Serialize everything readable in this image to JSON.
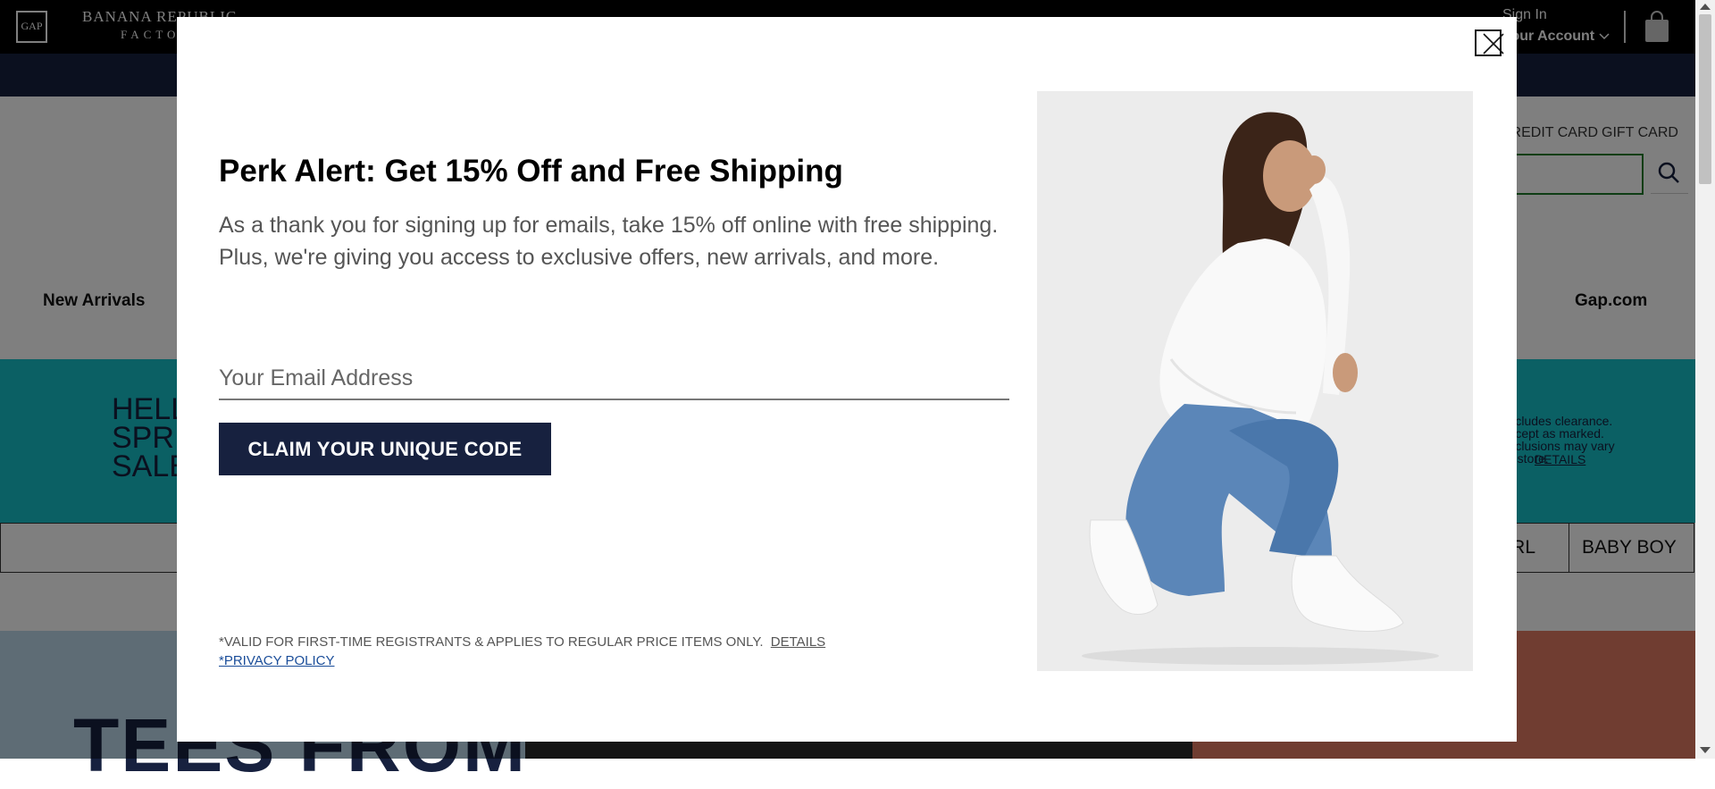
{
  "header": {
    "gap_logo": "GAP",
    "banana_republic": {
      "line1": "BANANA REPUBLIC",
      "line2": "FACTORY"
    },
    "sign_in": "Sign In",
    "your_account": "Your Account",
    "credit_card": "CREDIT CARD",
    "gift_card": "GIFT CARD"
  },
  "nav": {
    "new_arrivals": "New Arrivals",
    "gap_com": "Gap.com"
  },
  "teal_banner": {
    "title": "HELLO\nSPRING\nSALE",
    "fine": "Excludes clearance.\nExcept as marked.\nExclusions may vary\nby store.",
    "details": "DETAILS"
  },
  "categories": [
    "GIRL",
    "BABY BOY"
  ],
  "hero": {
    "left_text": "TEES FROM"
  },
  "modal": {
    "title": "Perk Alert: Get 15% Off and Free Shipping",
    "body": "As a thank you for signing up for emails, take 15% off online with free shipping. Plus, we're giving you access to exclusive offers, new arrivals, and more.",
    "email_placeholder": "Your Email Address",
    "email_value": "",
    "cta": "CLAIM YOUR UNIQUE CODE",
    "fine_print": "*VALID FOR FIRST-TIME REGISTRANTS & APPLIES TO REGULAR PRICE ITEMS ONLY.",
    "details": "DETAILS",
    "privacy": "*PRIVACY POLICY"
  },
  "colors": {
    "navy": "#17213f",
    "teal": "#17c0c8",
    "search_border": "#1c7a2a",
    "overlay": "rgba(0,0,0,0.5)"
  },
  "icons": [
    "close-icon",
    "search-icon",
    "bag-icon",
    "chevron-down-icon"
  ]
}
